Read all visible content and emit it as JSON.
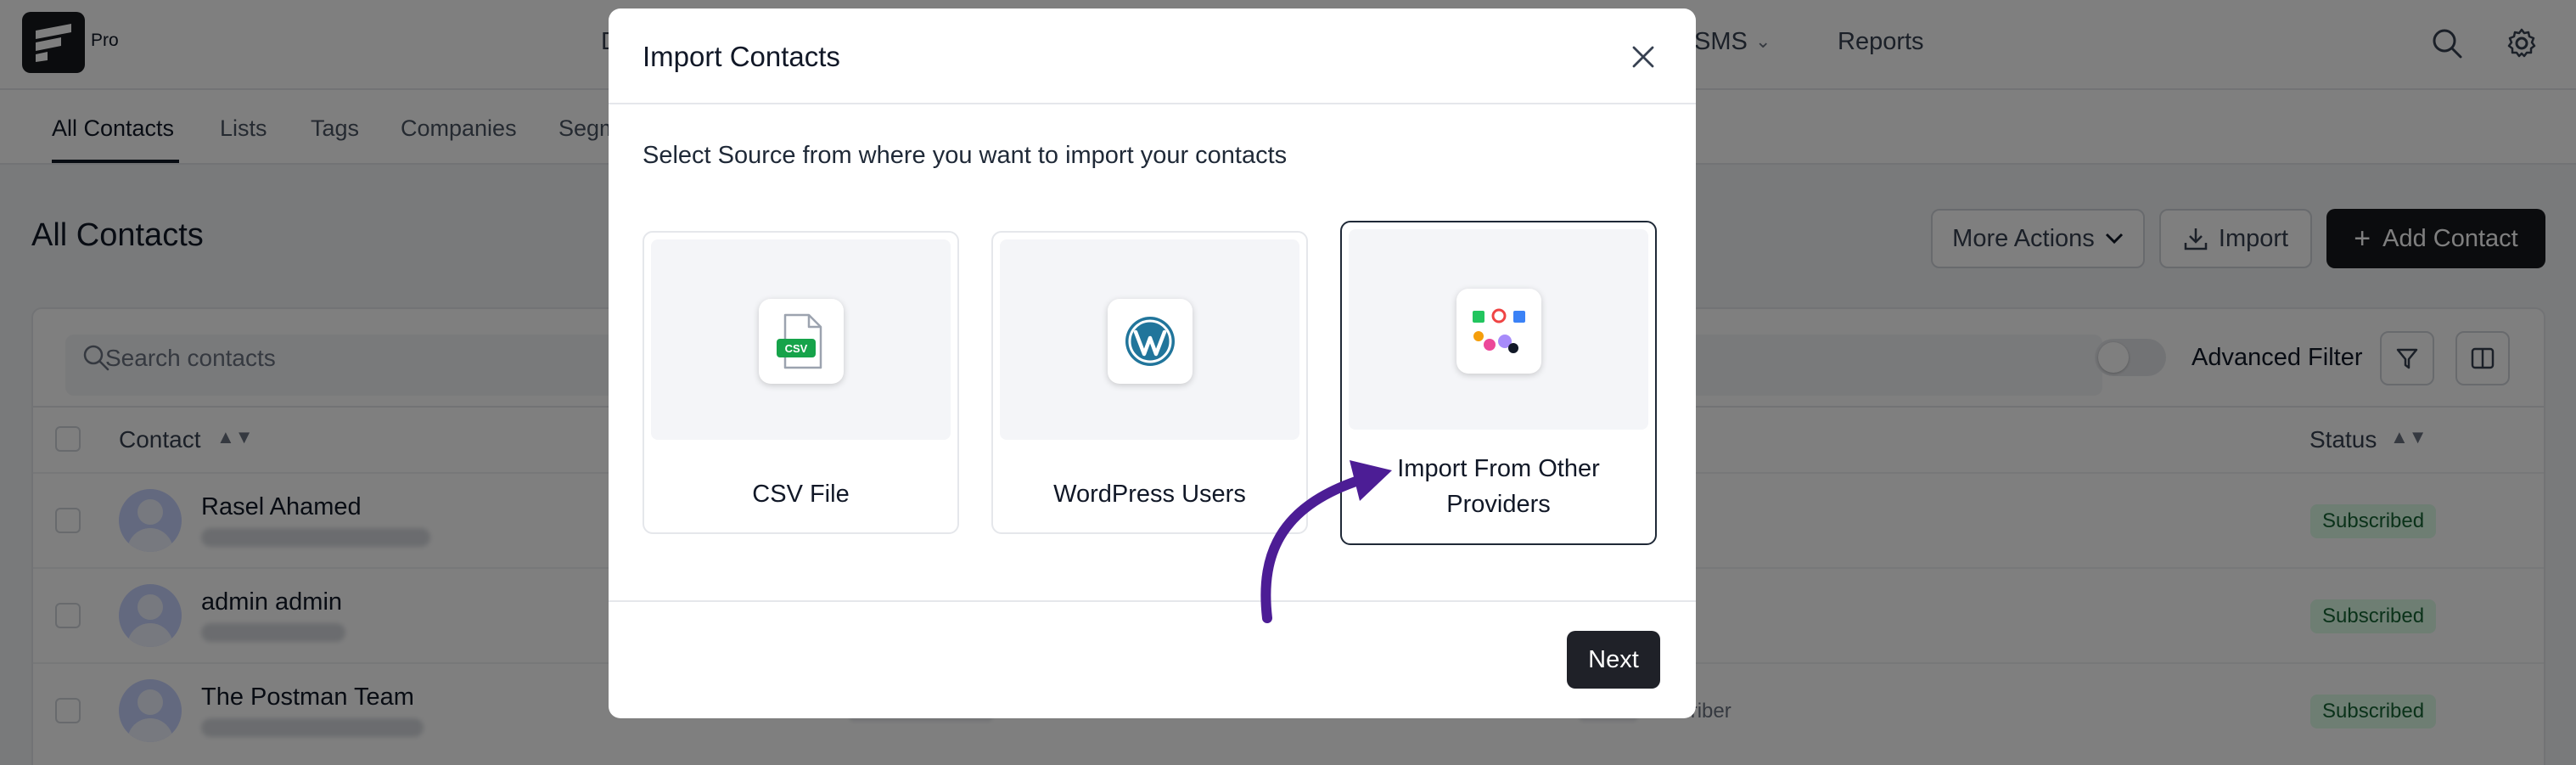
{
  "app": {
    "badge": "Pro",
    "top_nav": [
      {
        "label": "D"
      },
      {
        "label": "SMS"
      },
      {
        "label": "Reports"
      }
    ],
    "sub_nav": [
      {
        "label": "All Contacts"
      },
      {
        "label": "Lists"
      },
      {
        "label": "Tags"
      },
      {
        "label": "Companies"
      },
      {
        "label": "Segm"
      }
    ]
  },
  "page": {
    "title": "All Contacts",
    "more_actions_label": "More Actions",
    "import_label": "Import",
    "add_contact_label": "Add Contact",
    "search_placeholder": "Search contacts",
    "advanced_filter_label": "Advanced Filter",
    "columns": {
      "contact": "Contact",
      "status": "Status"
    },
    "rows": [
      {
        "name": "Rasel Ahamed",
        "status": "Subscribed"
      },
      {
        "name": "admin admin",
        "status": "Subscribed"
      },
      {
        "name": "The Postman Team",
        "status": "Subscribed",
        "tag": "Subscriber"
      }
    ]
  },
  "modal": {
    "title": "Import Contacts",
    "subtitle": "Select Source from where you want to import your contacts",
    "options": [
      {
        "label": "CSV File",
        "icon": "csv-file-icon",
        "icon_text": "CSV"
      },
      {
        "label": "WordPress Users",
        "icon": "wordpress-icon"
      },
      {
        "label_line1": "Import From Other",
        "label_line2": "Providers",
        "icon": "providers-icon"
      }
    ],
    "next_label": "Next"
  },
  "colors": {
    "accent_dark": "#1f2128",
    "arrow": "#4c1d95",
    "subscribed_bg": "#dcfce7",
    "subscribed_text": "#166534"
  }
}
